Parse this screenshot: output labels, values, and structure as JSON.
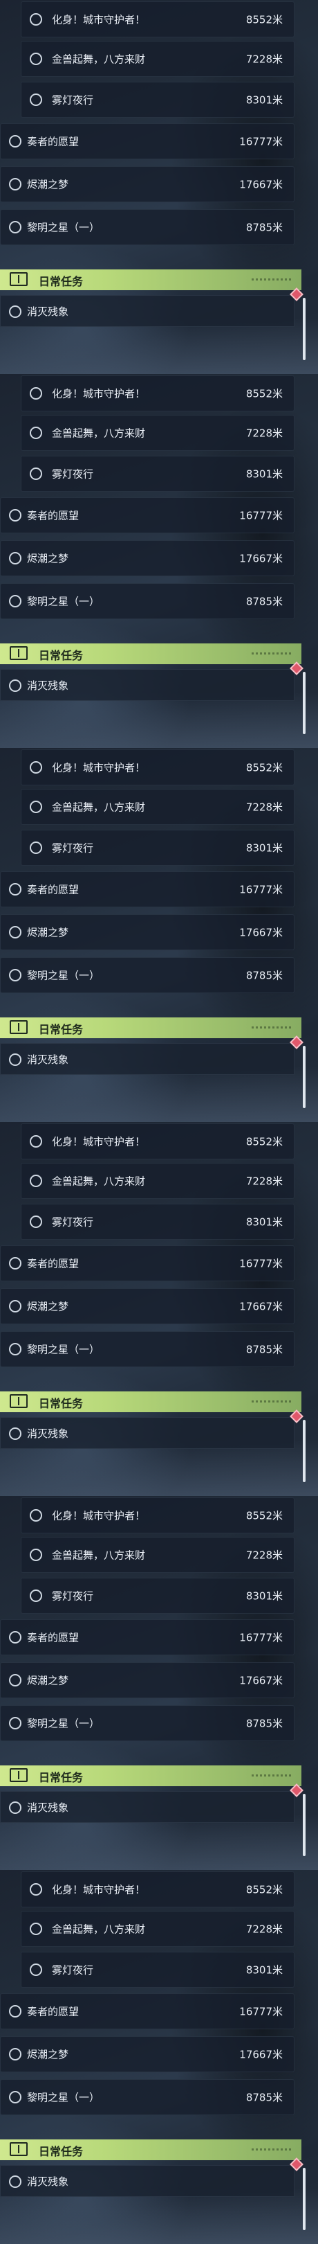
{
  "routes": [
    {
      "name": "化身！城市守护者！",
      "distance": "8552米",
      "indent": true
    },
    {
      "name": "金兽起舞，八方来财",
      "distance": "7228米",
      "indent": true
    },
    {
      "name": "雾灯夜行",
      "distance": "8301米",
      "indent": true
    },
    {
      "name": "奏者的愿望",
      "distance": "16777米",
      "indent": false
    },
    {
      "name": "烬潮之梦",
      "distance": "17667米",
      "indent": false
    },
    {
      "name": "黎明之星（一）",
      "distance": "8785米",
      "indent": false
    }
  ],
  "daily_section": {
    "title": "日常任务",
    "icon": "book-icon"
  },
  "daily_tasks": [
    {
      "name": "消灭残象"
    }
  ],
  "marker": {
    "icon": "diamond-marker-icon",
    "color": "#e0586b"
  }
}
